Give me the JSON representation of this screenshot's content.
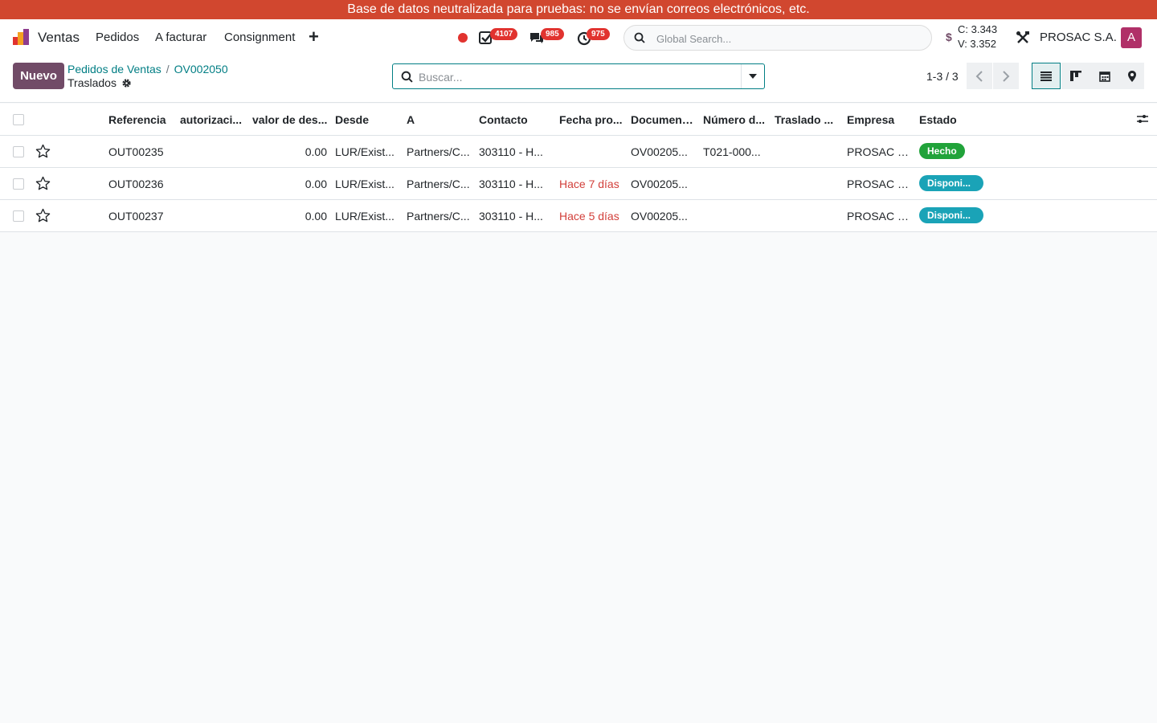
{
  "banner": "Base de datos neutralizada para pruebas: no se envían correos electrónicos, etc.",
  "navbar": {
    "app_name": "Ventas",
    "menu": [
      "Pedidos",
      "A facturar",
      "Consignment"
    ],
    "plus": "+",
    "badges": {
      "activities": "4107",
      "messages": "985",
      "timers": "975"
    },
    "search_placeholder": "Global Search...",
    "currency_symbol": "$",
    "rate_c": "C: 3.343",
    "rate_v": "V: 3.352",
    "company": "PROSAC S.A.",
    "avatar_letter": "A"
  },
  "control": {
    "new_label": "Nuevo",
    "breadcrumb": [
      "Pedidos de Ventas",
      "OV002050"
    ],
    "breadcrumb_sep": "/",
    "subtitle": "Traslados",
    "search_placeholder": "Buscar...",
    "pager": "1-3 / 3"
  },
  "table": {
    "headers": [
      "Referencia",
      "autorizaci...",
      "valor de des...",
      "Desde",
      "A",
      "Contacto",
      "Fecha pro...",
      "Document...",
      "Número d...",
      "Traslado ...",
      "Empresa",
      "Estado"
    ],
    "rows": [
      {
        "ref": "OUT00235",
        "valor": "0.00",
        "desde": "LUR/Exist...",
        "a": "Partners/C...",
        "contacto": "303110 - H...",
        "fecha": "",
        "doc": "OV00205...",
        "numero": "T021-000...",
        "empresa": "PROSAC S...",
        "estado": "Hecho"
      },
      {
        "ref": "OUT00236",
        "valor": "0.00",
        "desde": "LUR/Exist...",
        "a": "Partners/C...",
        "contacto": "303110 - H...",
        "fecha": "Hace 7 días",
        "doc": "OV00205...",
        "numero": "",
        "empresa": "PROSAC S...",
        "estado": "Disponi..."
      },
      {
        "ref": "OUT00237",
        "valor": "0.00",
        "desde": "LUR/Exist...",
        "a": "Partners/C...",
        "contacto": "303110 - H...",
        "fecha": "Hace 5 días",
        "doc": "OV00205...",
        "numero": "",
        "empresa": "PROSAC S...",
        "estado": "Disponi..."
      }
    ]
  },
  "colors": {
    "banner": "#d1472f",
    "brand": "#714b67",
    "link": "#017e84",
    "done": "#21a33a",
    "available": "#1aa3b7",
    "overdue": "#d23f3a"
  }
}
